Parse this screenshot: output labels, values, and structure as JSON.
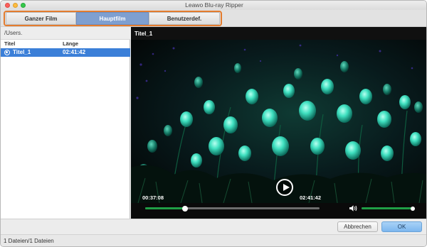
{
  "window": {
    "title": "Leawo Blu-ray Ripper"
  },
  "mode_tabs": [
    {
      "label": "Ganzer Film",
      "selected": false
    },
    {
      "label": "Hauptfilm",
      "selected": true
    },
    {
      "label": "Benutzerdef.",
      "selected": false
    }
  ],
  "title_list": {
    "path": "/Users.",
    "columns": {
      "title": "Titel",
      "length": "Länge"
    },
    "rows": [
      {
        "title": "Titel_1",
        "length": "02:41:42",
        "selected": true
      }
    ]
  },
  "preview": {
    "title": "Titel_1",
    "current_time": "00:37:08",
    "total_time": "02:41:42",
    "seek_progress": 0.23,
    "volume_level": 1.0
  },
  "buttons": {
    "cancel": "Abbrechen",
    "ok": "OK"
  },
  "status": {
    "text": "1 Dateien/1 Dateien"
  },
  "colors": {
    "accent_orange": "#e47c2e",
    "tab_selected": "#7e9fd0",
    "row_selected": "#3b7fd8",
    "progress_green": "#1f9f46",
    "ok_button": "#7cb7ee"
  }
}
